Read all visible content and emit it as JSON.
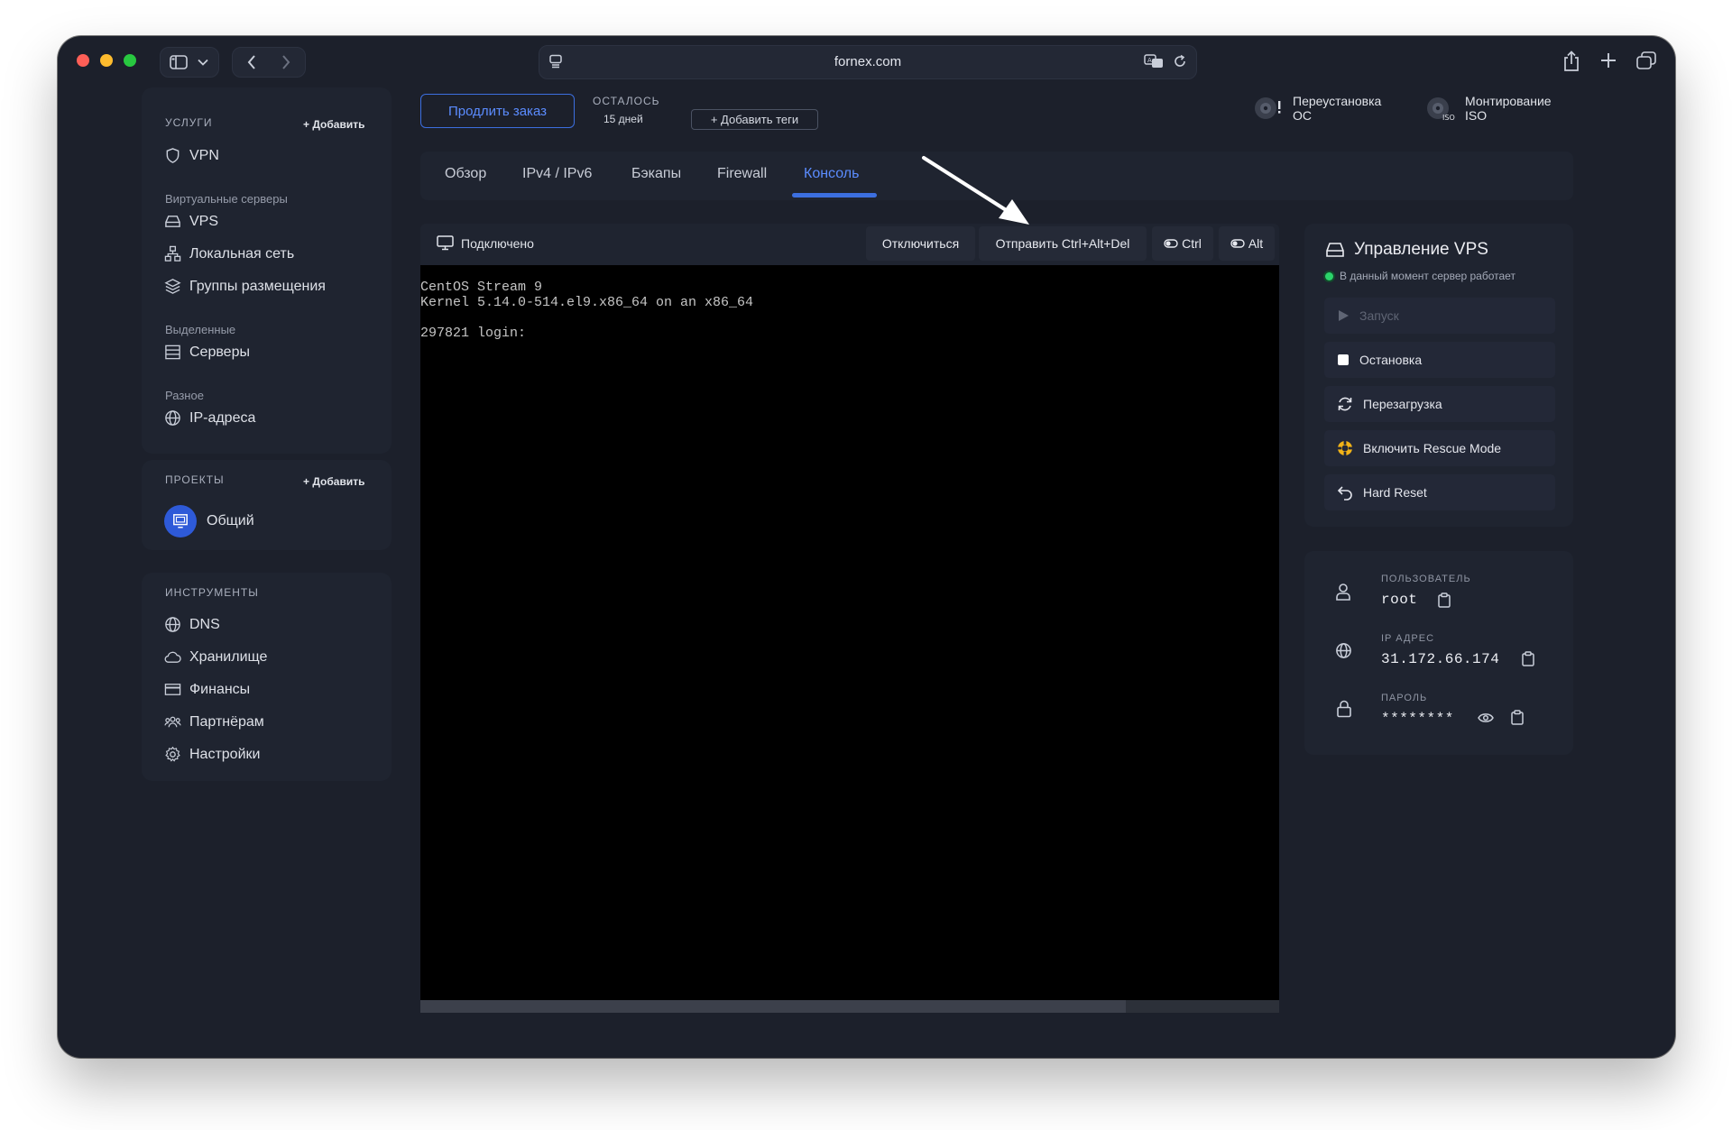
{
  "browser": {
    "url": "fornex.com"
  },
  "sidebar": {
    "services_header": "УСЛУГИ",
    "services_add": "+ Добавить",
    "vpn": "VPN",
    "virtual_servers_label": "Виртуальные серверы",
    "vps": "VPS",
    "local_network": "Локальная сеть",
    "placement_groups": "Группы размещения",
    "dedicated_label": "Выделенные",
    "servers": "Серверы",
    "misc_label": "Разное",
    "ip_addresses": "IP-адреса",
    "projects_header": "ПРОЕКТЫ",
    "projects_add": "+ Добавить",
    "project_general": "Общий",
    "tools_header": "ИНСТРУМЕНТЫ",
    "dns": "DNS",
    "storage": "Хранилище",
    "finance": "Финансы",
    "partners": "Партнёрам",
    "settings": "Настройки"
  },
  "top": {
    "extend_order": "Продлить заказ",
    "remaining_label": "ОСТАЛОСЬ",
    "remaining_value": "15 дней",
    "add_tags": "+ Добавить теги",
    "reinstall_line1": "Переустановка",
    "reinstall_line2": "ОС",
    "mount_line1": "Монтирование",
    "mount_line2": "ISO"
  },
  "tabs": {
    "overview": "Обзор",
    "ip": "IPv4 / IPv6",
    "backups": "Бэкапы",
    "firewall": "Firewall",
    "console": "Консоль",
    "active": "console"
  },
  "console": {
    "status": "Подключено",
    "disconnect": "Отключиться",
    "send_cad": "Отправить Ctrl+Alt+Del",
    "ctrl": "Ctrl",
    "alt": "Alt",
    "lines": [
      "CentOS Stream 9",
      "Kernel 5.14.0-514.el9.x86_64 on an x86_64",
      "",
      "297821 login:"
    ]
  },
  "vps_panel": {
    "title": "Управление VPS",
    "status": "В данный момент сервер работает",
    "start": "Запуск",
    "stop": "Остановка",
    "restart": "Перезагрузка",
    "rescue": "Включить Rescue Mode",
    "hard_reset": "Hard Reset"
  },
  "credentials": {
    "user_label": "ПОЛЬЗОВАТЕЛЬ",
    "user_value": "root",
    "ip_label": "IP АДРЕС",
    "ip_value": "31.172.66.174",
    "password_label": "ПАРОЛЬ",
    "password_value": "********"
  },
  "colors": {
    "accent": "#3c6fe0",
    "status_ok": "#2bd36a",
    "background": "#1c202b"
  }
}
